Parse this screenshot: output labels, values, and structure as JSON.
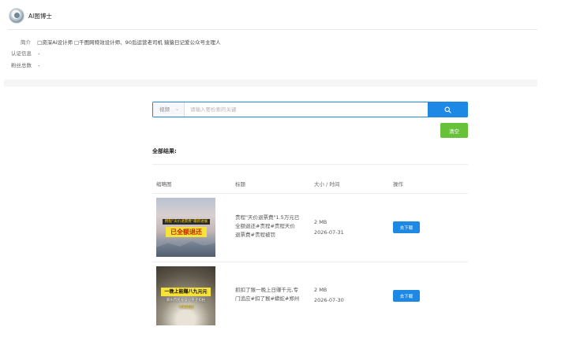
{
  "profile": {
    "name": "AI图博士",
    "intro_label": "简介",
    "intro_value": "□资深Ai设计师 □千图网特效设计师、90后运营老司机 猿猿日记爱公众号主理人",
    "cert_label": "认证信息",
    "cert_value": "-",
    "fans_label": "粉丝总数",
    "fans_value": "-"
  },
  "search": {
    "type_value": "视频",
    "placeholder": "请输入要检索的关键",
    "button_icon": "search-icon"
  },
  "actions": {
    "clear_label": "清空"
  },
  "results": {
    "heading": "全部结果:",
    "columns": {
      "thumb": "缩略图",
      "title": "标题",
      "size_time": "大小 / 时间",
      "action": "操作"
    },
    "items": [
      {
        "title": "责程\"天价退票费\"1.5万元已全额退还#责程#责程天价退票费#责程被罚",
        "size": "2 MB",
        "date": "2026-07-31",
        "thumb_text_1": "携程“天价退票费”最新进展",
        "thumb_text_2": "已全额退还",
        "download_label": "去下载"
      },
      {
        "title": "抓扣了猴一晚上日赚千元,专门追应#扣了猴#蟒蛇#郑州",
        "size": "2 MB",
        "date": "2026-07-30",
        "thumb_text_1": "一晚上能赚八九元元",
        "thumb_text_2": "郑州市民身穿小夹子扣拍",
        "thumb_text_3": "专家提醒",
        "download_label": "去下载"
      }
    ]
  },
  "colors": {
    "primary": "#1e88e5",
    "success": "#67c23a"
  }
}
